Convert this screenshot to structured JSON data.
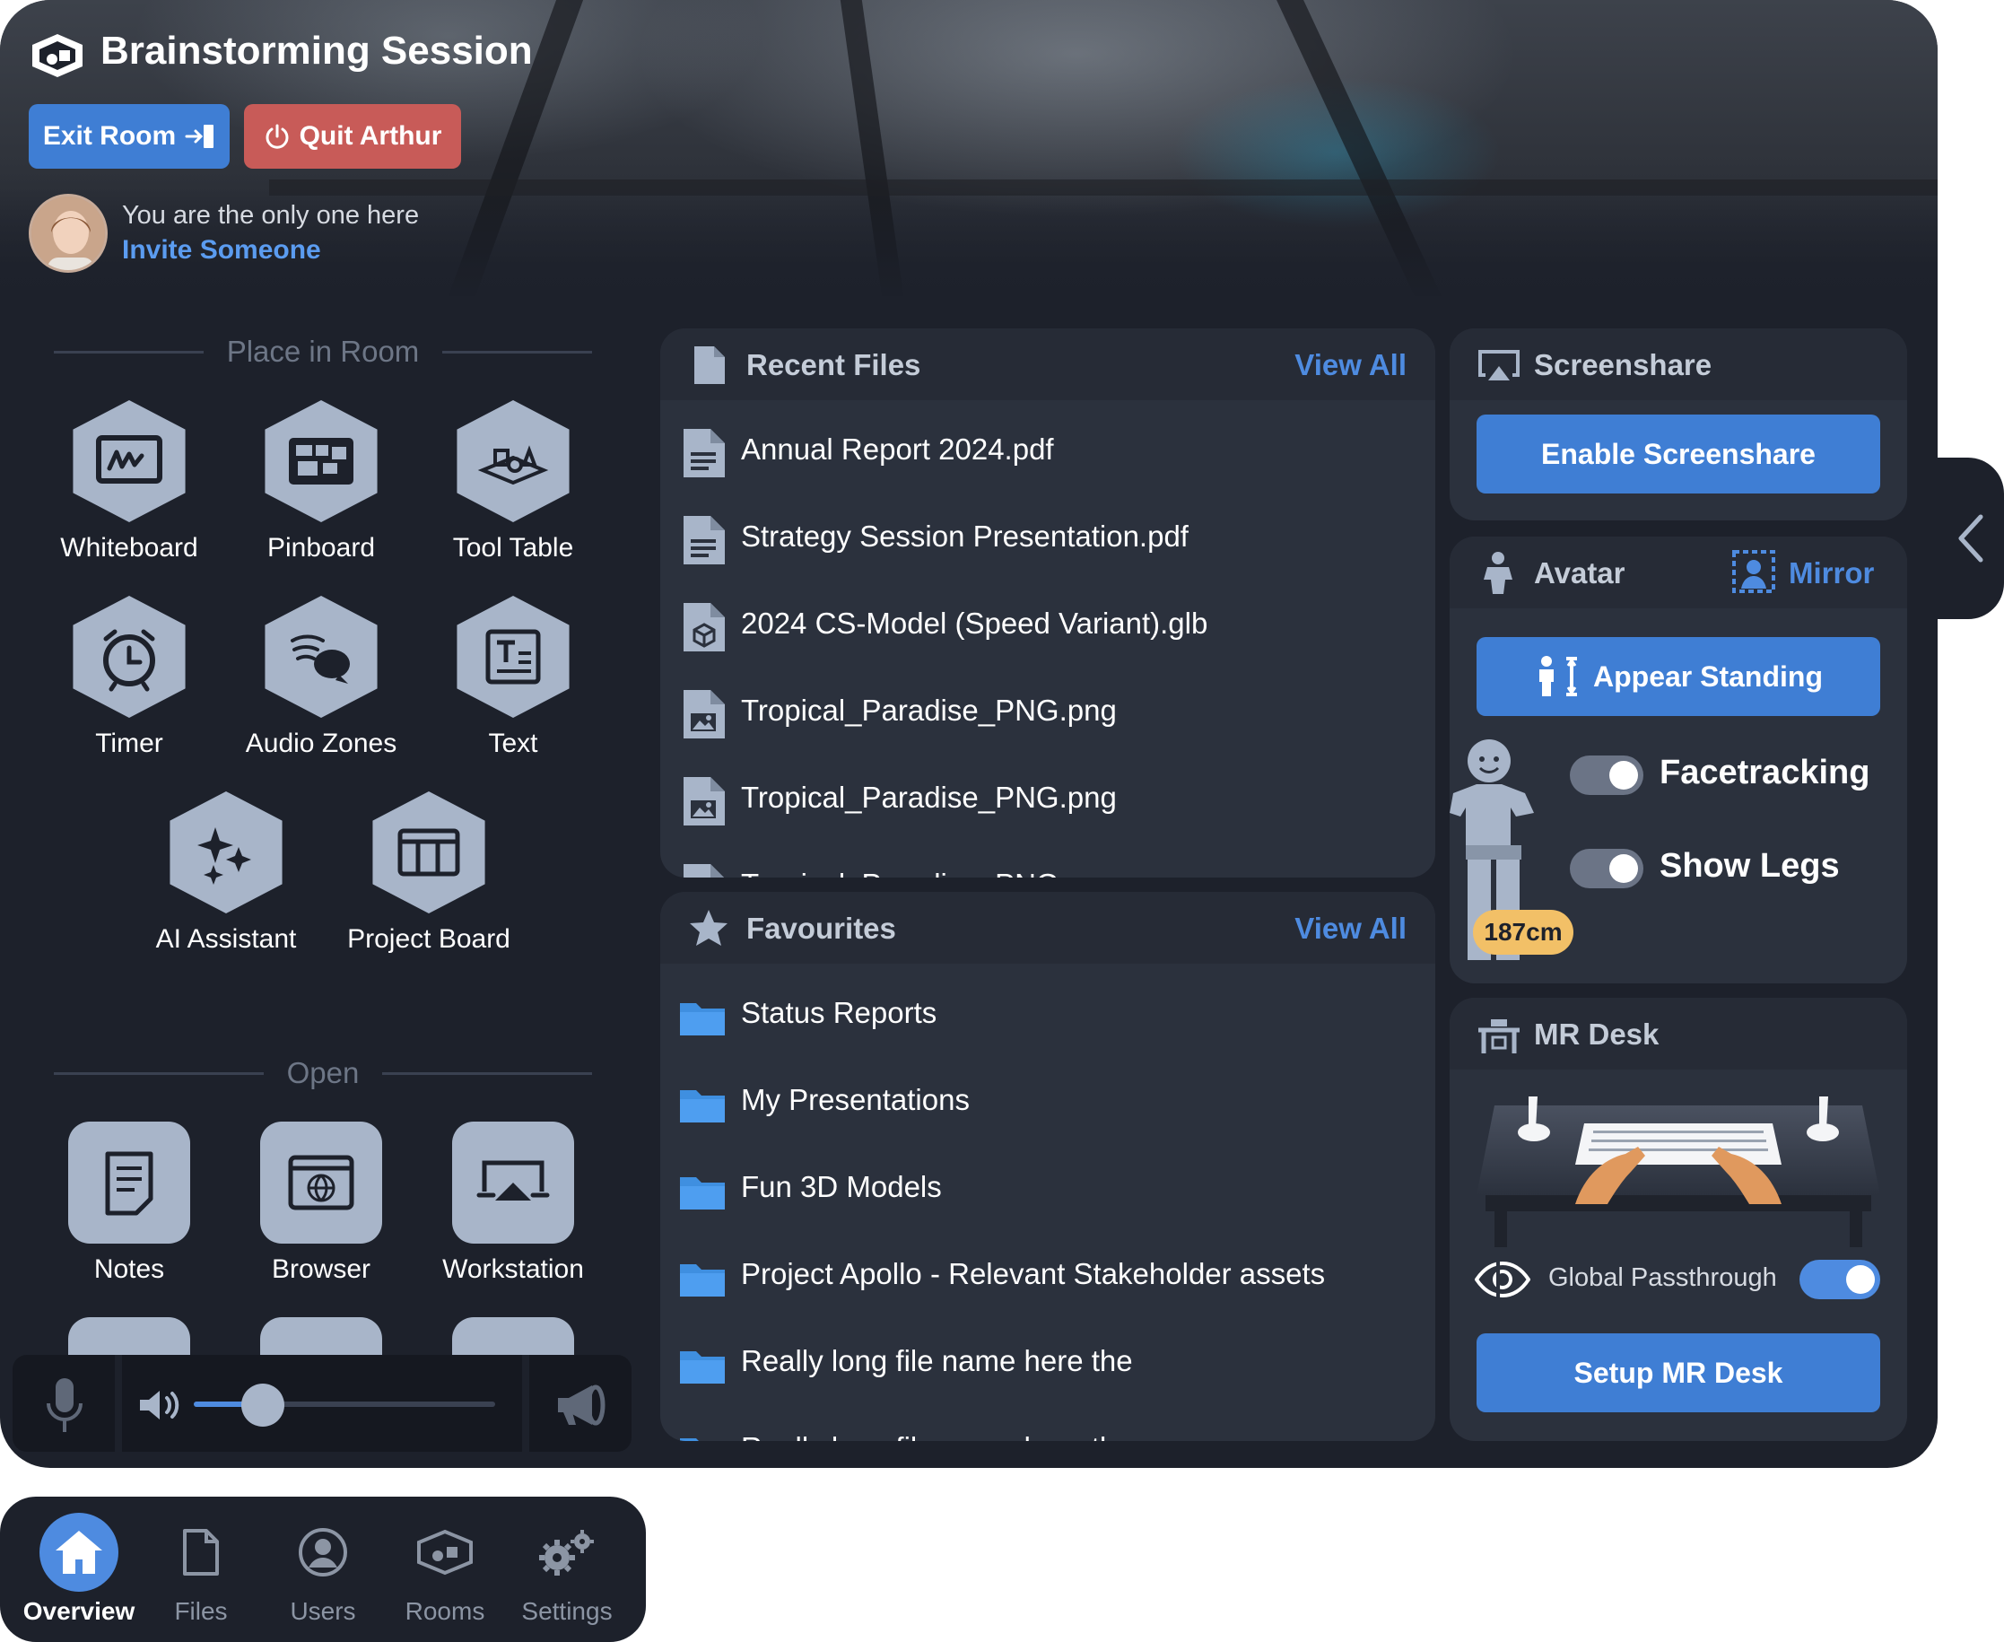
{
  "header": {
    "title": "Brainstorming Session",
    "exit_label": "Exit Room",
    "quit_label": "Quit Arthur",
    "presence_text": "You are the only one here",
    "invite_label": "Invite Someone"
  },
  "place_in_room": {
    "heading": "Place in Room",
    "tools": [
      {
        "label": "Whiteboard",
        "icon": "whiteboard-icon"
      },
      {
        "label": "Pinboard",
        "icon": "pinboard-icon"
      },
      {
        "label": "Tool Table",
        "icon": "tool-table-icon"
      },
      {
        "label": "Timer",
        "icon": "timer-icon"
      },
      {
        "label": "Audio Zones",
        "icon": "audio-zones-icon"
      },
      {
        "label": "Text",
        "icon": "text-icon"
      },
      {
        "label": "AI Assistant",
        "icon": "sparkles-icon"
      },
      {
        "label": "Project Board",
        "icon": "project-board-icon"
      }
    ]
  },
  "open": {
    "heading": "Open",
    "apps": [
      {
        "label": "Notes",
        "icon": "notes-icon"
      },
      {
        "label": "Browser",
        "icon": "browser-icon"
      },
      {
        "label": "Workstation",
        "icon": "workstation-icon"
      }
    ]
  },
  "audio": {
    "volume_percent": 23
  },
  "recent_files": {
    "title": "Recent Files",
    "view_all": "View All",
    "items": [
      {
        "name": "Annual Report 2024.pdf",
        "icon": "document-file-icon"
      },
      {
        "name": "Strategy Session Presentation.pdf",
        "icon": "document-file-icon"
      },
      {
        "name": "2024 CS-Model (Speed Variant).glb",
        "icon": "model-file-icon"
      },
      {
        "name": "Tropical_Paradise_PNG.png",
        "icon": "image-file-icon"
      },
      {
        "name": "Tropical_Paradise_PNG.png",
        "icon": "image-file-icon"
      },
      {
        "name": "Tropical_Paradise_PNG.png",
        "icon": "image-file-icon"
      }
    ]
  },
  "favourites": {
    "title": "Favourites",
    "view_all": "View All",
    "items": [
      {
        "name": "Status Reports"
      },
      {
        "name": "My Presentations"
      },
      {
        "name": "Fun 3D Models"
      },
      {
        "name": "Project Apollo - Relevant Stakeholder assets"
      },
      {
        "name": "Really long file name here the"
      },
      {
        "name": "Really long file name here the"
      }
    ]
  },
  "screenshare": {
    "title": "Screenshare",
    "button": "Enable Screenshare"
  },
  "avatar": {
    "title": "Avatar",
    "mirror_label": "Mirror",
    "appear_button": "Appear Standing",
    "facetracking_label": "Facetracking",
    "facetracking_on": true,
    "show_legs_label": "Show Legs",
    "show_legs_on": true,
    "height": "187cm"
  },
  "mr_desk": {
    "title": "MR Desk",
    "passthrough_label": "Global Passthrough",
    "passthrough_on": true,
    "setup_button": "Setup MR Desk"
  },
  "nav": {
    "items": [
      {
        "label": "Overview",
        "icon": "home-icon",
        "active": true
      },
      {
        "label": "Files",
        "icon": "file-icon",
        "active": false
      },
      {
        "label": "Users",
        "icon": "user-icon",
        "active": false
      },
      {
        "label": "Rooms",
        "icon": "rooms-icon",
        "active": false
      },
      {
        "label": "Settings",
        "icon": "gears-icon",
        "active": false
      }
    ]
  },
  "colors": {
    "panel": "#1d212b",
    "card": "#2b313d",
    "accent_blue": "#3f7ed4",
    "link_blue": "#4e8be0",
    "quit_red": "#c85b58",
    "icon_tile": "#a8b5c9",
    "badge": "#f2c067"
  }
}
